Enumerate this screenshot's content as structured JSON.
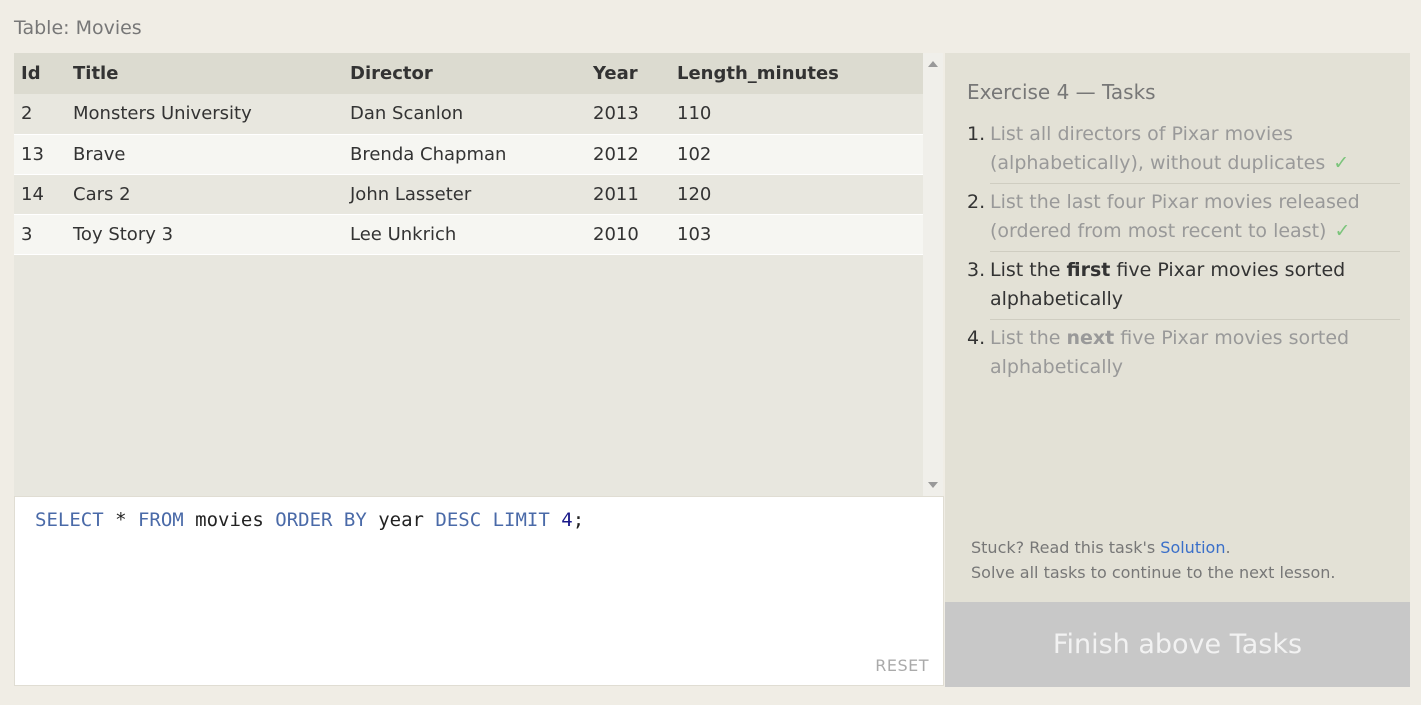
{
  "table_title": "Table: Movies",
  "results": {
    "columns": [
      "Id",
      "Title",
      "Director",
      "Year",
      "Length_minutes"
    ],
    "rows": [
      [
        "2",
        "Monsters University",
        "Dan Scanlon",
        "2013",
        "110"
      ],
      [
        "13",
        "Brave",
        "Brenda Chapman",
        "2012",
        "102"
      ],
      [
        "14",
        "Cars 2",
        "John Lasseter",
        "2011",
        "120"
      ],
      [
        "3",
        "Toy Story 3",
        "Lee Unkrich",
        "2010",
        "103"
      ]
    ]
  },
  "editor": {
    "query_tokens": {
      "select": "SELECT",
      "star": " * ",
      "from": "FROM",
      "table": " movies ",
      "order_by": "ORDER BY",
      "col": " year ",
      "desc": "DESC",
      "limit": " LIMIT ",
      "limit_val": "4",
      "semicolon": ";"
    },
    "reset_label": "RESET"
  },
  "tasks": {
    "title": "Exercise 4 — Tasks",
    "check": "✓",
    "items": [
      {
        "num": "1.",
        "text": "List all directors of Pixar movies (alphabetically), without duplicates",
        "status": "done"
      },
      {
        "num": "2.",
        "text": "List the last four Pixar movies released (ordered from most recent to least)",
        "status": "done"
      },
      {
        "num": "3.",
        "pre": "List the ",
        "bold": "first",
        "post": " five Pixar movies sorted alphabetically",
        "status": "active"
      },
      {
        "num": "4.",
        "pre": "List the ",
        "bold": "next",
        "post": " five Pixar movies sorted alphabetically",
        "status": "pending"
      }
    ],
    "help_prefix": "Stuck? Read this task's ",
    "help_link": "Solution",
    "help_suffix": ".",
    "help_line2": "Solve all tasks to continue to the next lesson."
  },
  "finish_button": "Finish above Tasks",
  "colors": {
    "keyword": "#4a6aa8",
    "check": "#7bc47b",
    "link": "#3a6fc9",
    "finish_bg": "#c8c8c8"
  }
}
